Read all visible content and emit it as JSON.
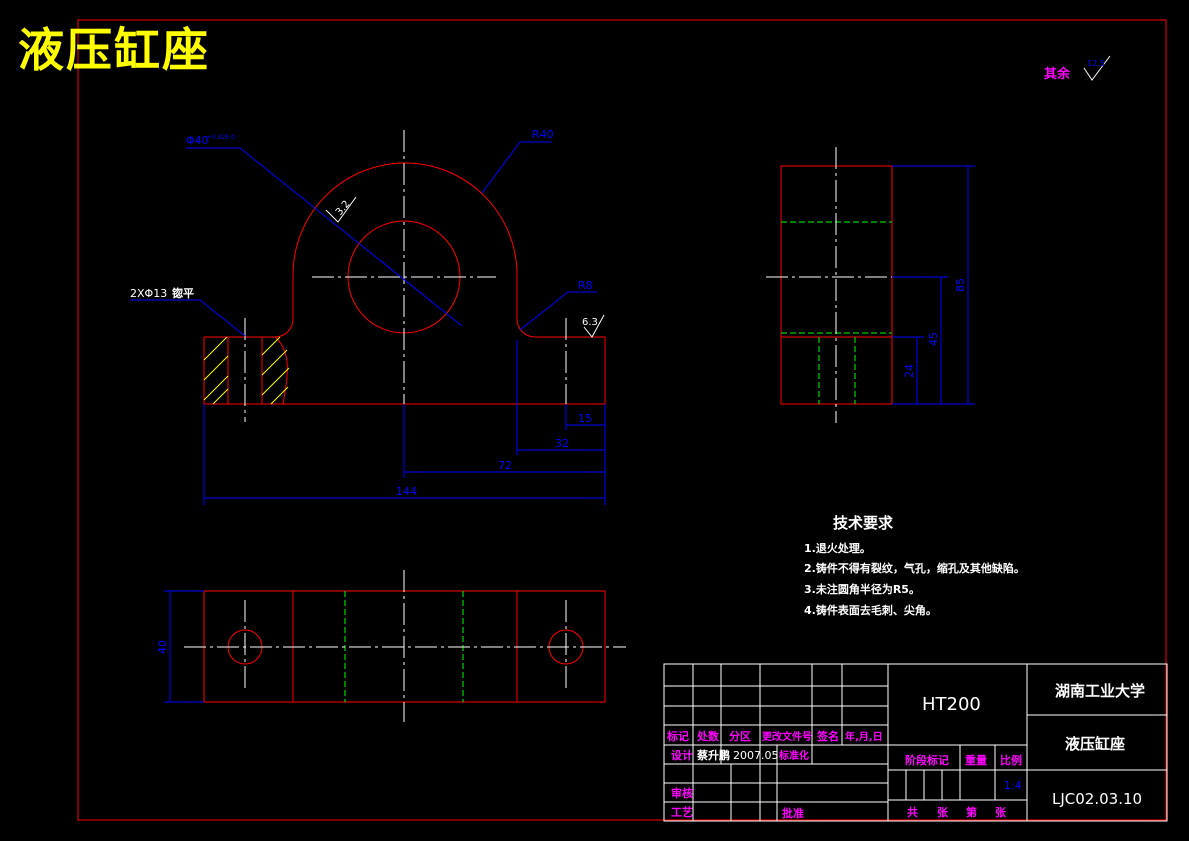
{
  "drawing_title": "液压缸座",
  "surface_note": {
    "label": "其余",
    "roughness": "12.5"
  },
  "dimensions": {
    "bore": "Φ40",
    "bore_tol": "+0.025\n0",
    "bore_roughness": "3.2",
    "outer_radius": "R40",
    "fillet_radius": "R8",
    "holes": "2XΦ13",
    "holes_note": "锪平",
    "top_roughness": "6.3",
    "d15": "15",
    "d32": "32",
    "d72": "72",
    "d144": "144",
    "d85": "85",
    "d45": "45",
    "d24": "24",
    "d40": "40"
  },
  "tech_requirements": {
    "title": "技术要求",
    "items": [
      "1.退火处理。",
      "2.铸件不得有裂纹，气孔，缩孔及其他缺陷。",
      "3.未注圆角半径为R5。",
      "4.铸件表面去毛刺、尖角。"
    ]
  },
  "title_block": {
    "material": "HT200",
    "university": "湖南工业大学",
    "part_name": "液压缸座",
    "drawing_number": "LJC02.03.10",
    "headers": [
      "标记",
      "处数",
      "分区",
      "更改文件号",
      "签名",
      "年,月,日"
    ],
    "design_label": "设计",
    "designer": "蔡升鹏",
    "date": "2007.05",
    "standardization": "标准化",
    "review": "审核",
    "craft": "工艺",
    "approve": "批准",
    "stage_mark": "阶段标记",
    "weight": "重量",
    "scale": "比例",
    "scale_value": "1:4",
    "sheet_total": "共",
    "sheet_unit1": "张",
    "sheet_nth": "第",
    "sheet_unit2": "张"
  },
  "colors": {
    "outline": "#ff0000",
    "centerline": "#ffffff",
    "dimension": "#0000ff",
    "hidden": "#00ff00",
    "title": "#ffff00",
    "label": "#ff00ff",
    "hatch": "#ffff00"
  }
}
